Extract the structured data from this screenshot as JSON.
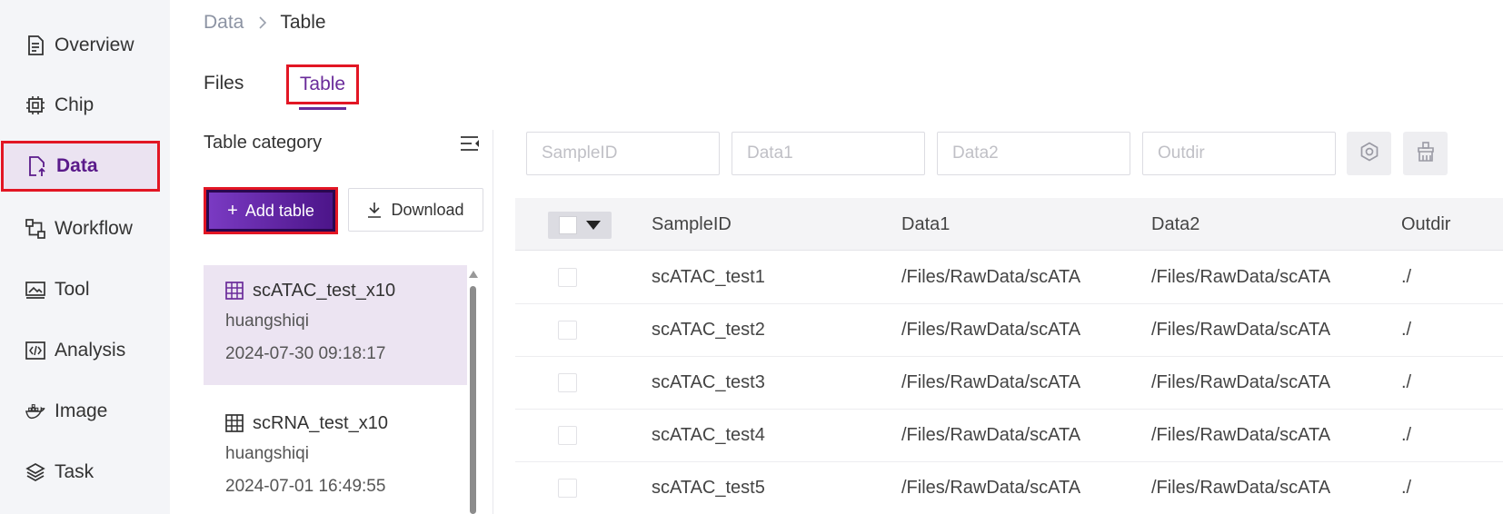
{
  "sidebar": {
    "items": [
      {
        "label": "Overview",
        "icon": "document-icon"
      },
      {
        "label": "Chip",
        "icon": "chip-icon"
      },
      {
        "label": "Data",
        "icon": "file-upload-icon",
        "active": true
      },
      {
        "label": "Workflow",
        "icon": "workflow-icon"
      },
      {
        "label": "Tool",
        "icon": "image-tool-icon"
      },
      {
        "label": "Analysis",
        "icon": "code-icon"
      },
      {
        "label": "Image",
        "icon": "docker-icon"
      },
      {
        "label": "Task",
        "icon": "layers-icon"
      }
    ]
  },
  "breadcrumb": {
    "parent": "Data",
    "current": "Table"
  },
  "tabs": {
    "files": "Files",
    "table": "Table",
    "active": "Table"
  },
  "category": {
    "title": "Table category",
    "add_label": "Add table",
    "download_label": "Download",
    "items": [
      {
        "name": "scATAC_test_x10",
        "owner": "huangshiqi",
        "date": "2024-07-30 09:18:17",
        "selected": true
      },
      {
        "name": "scRNA_test_x10",
        "owner": "huangshiqi",
        "date": "2024-07-01 16:49:55",
        "selected": false
      }
    ]
  },
  "filters": {
    "placeholders": [
      "SampleID",
      "Data1",
      "Data2",
      "Outdir"
    ]
  },
  "table": {
    "columns": [
      "SampleID",
      "Data1",
      "Data2",
      "Outdir"
    ],
    "rows": [
      [
        "scATAC_test1",
        "/Files/RawData/scATA",
        "/Files/RawData/scATA",
        "./"
      ],
      [
        "scATAC_test2",
        "/Files/RawData/scATA",
        "/Files/RawData/scATA",
        "./"
      ],
      [
        "scATAC_test3",
        "/Files/RawData/scATA",
        "/Files/RawData/scATA",
        "./"
      ],
      [
        "scATAC_test4",
        "/Files/RawData/scATA",
        "/Files/RawData/scATA",
        "./"
      ],
      [
        "scATAC_test5",
        "/Files/RawData/scATA",
        "/Files/RawData/scATA",
        "./"
      ]
    ]
  },
  "colors": {
    "accent": "#6a2b9a",
    "highlight": "#e21624",
    "sidebar_bg": "#f4f5f8",
    "selected_bg": "#ece4f2"
  }
}
